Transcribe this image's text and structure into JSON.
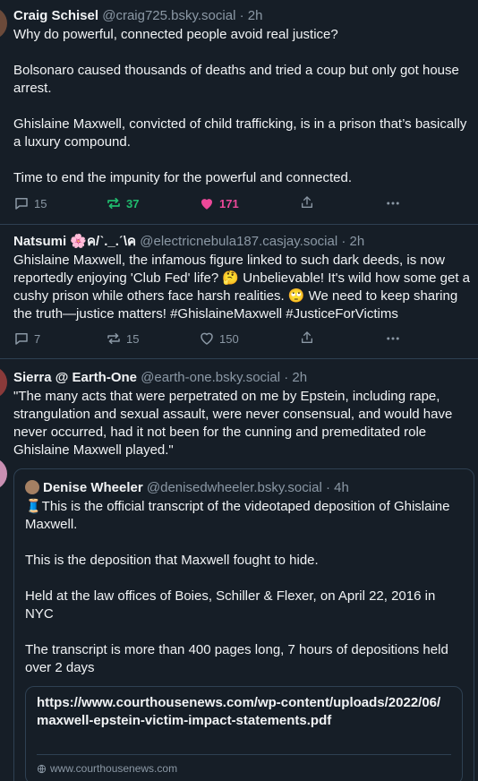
{
  "posts": [
    {
      "author_name": "Craig Schisel",
      "author_handle": "@craig725.bsky.social",
      "time": "· 2h",
      "text": "Why do powerful, connected people avoid real justice?\n\nBolsonaro caused thousands of deaths and tried a coup but only got house arrest.\n\nGhislaine Maxwell, convicted of child trafficking, is in a prison that’s basically a luxury compound.\n\nTime to end the impunity for the powerful and connected.",
      "replies": "15",
      "reposts": "37",
      "likes": "171",
      "reposted": true,
      "liked": true
    },
    {
      "author_name": "Natsumi 🌸ค/ˋ._.ˊ\\ค",
      "author_handle": "@electricnebula187.casjay.social",
      "time": "· 2h",
      "text": "Ghislaine Maxwell, the infamous figure linked to such dark deeds, is now reportedly enjoying 'Club Fed' life? 🤔 Unbelievable! It's wild how some get a cushy prison while others face harsh realities. 🙄 We need to keep sharing the truth—justice matters! #GhislaineMaxwell #JusticeForVictims",
      "replies": "7",
      "reposts": "15",
      "likes": "150",
      "reposted": false,
      "liked": false
    },
    {
      "author_name": "Sierra @ Earth-One",
      "author_handle": "@earth-one.bsky.social",
      "time": "· 2h",
      "text": "\"The many acts that were perpetrated on me by Epstein, including rape, strangulation and sexual assault, were never consensual, and would have never occurred, had it not been for the cunning and premeditated role Ghislaine Maxwell played.\"",
      "quote": {
        "author_name": "Denise Wheeler",
        "author_handle": "@denisedwheeler.bsky.social",
        "time": "· 4h",
        "text": "🧵This is the official transcript of the videotaped deposition of Ghislaine Maxwell.\n\nThis is the deposition that Maxwell fought to hide.\n\nHeld at the law offices of Boies, Schiller & Flexer, on April 22, 2016 in NYC\n\nThe transcript is more than 400 pages long, 7 hours of depositions held over 2 days",
        "link_title": "https://www.courthousenews.com/wp-content/uploads/2022/06/maxwell-epstein-victim-impact-statements.pdf",
        "link_domain": "www.courthousenews.com"
      }
    }
  ],
  "colors": {
    "background": "#161e27",
    "border": "#2e4052",
    "muted": "#8b98a5",
    "repost_active": "#20bc6e",
    "like_active": "#ec4899"
  },
  "icons": [
    "reply-icon",
    "repost-icon",
    "heart-icon",
    "share-icon",
    "more-icon",
    "globe-icon"
  ]
}
